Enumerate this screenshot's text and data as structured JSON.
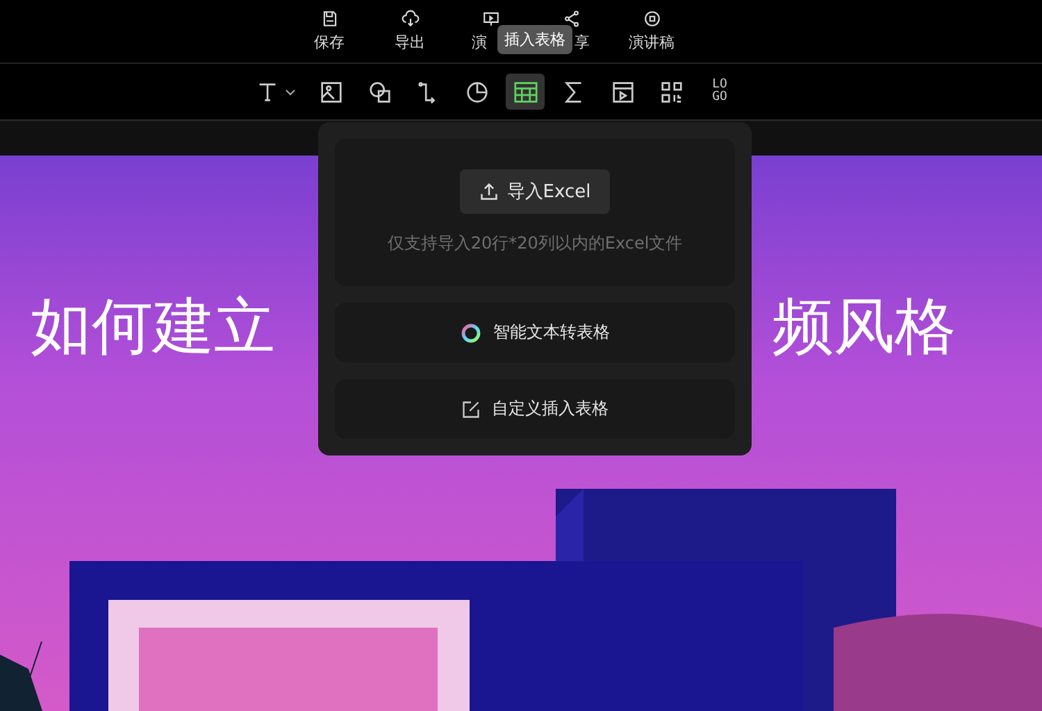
{
  "top_actions": [
    {
      "kind": "save",
      "label": "保存"
    },
    {
      "kind": "export",
      "label": "导出"
    },
    {
      "kind": "present",
      "label": "演"
    },
    {
      "kind": "share",
      "label": "享"
    },
    {
      "kind": "notes",
      "label": "演讲稿"
    }
  ],
  "tooltip": "插入表格",
  "toolbar": [
    {
      "kind": "text",
      "selected": false
    },
    {
      "kind": "image",
      "selected": false
    },
    {
      "kind": "shape",
      "selected": false
    },
    {
      "kind": "connector",
      "selected": false
    },
    {
      "kind": "chart",
      "selected": false
    },
    {
      "kind": "table",
      "selected": true
    },
    {
      "kind": "formula",
      "selected": false
    },
    {
      "kind": "video",
      "selected": false
    },
    {
      "kind": "qrcode",
      "selected": false
    },
    {
      "kind": "logo",
      "selected": false,
      "label": "LOGO"
    }
  ],
  "slide": {
    "title_left": "如何建立",
    "title_right": "频风格"
  },
  "popup": {
    "import_button": "导入Excel",
    "import_hint": "仅支持导入20行*20列以内的Excel文件",
    "options": [
      {
        "kind": "ai",
        "label": "智能文本转表格"
      },
      {
        "kind": "custom",
        "label": "自定义插入表格"
      }
    ]
  }
}
